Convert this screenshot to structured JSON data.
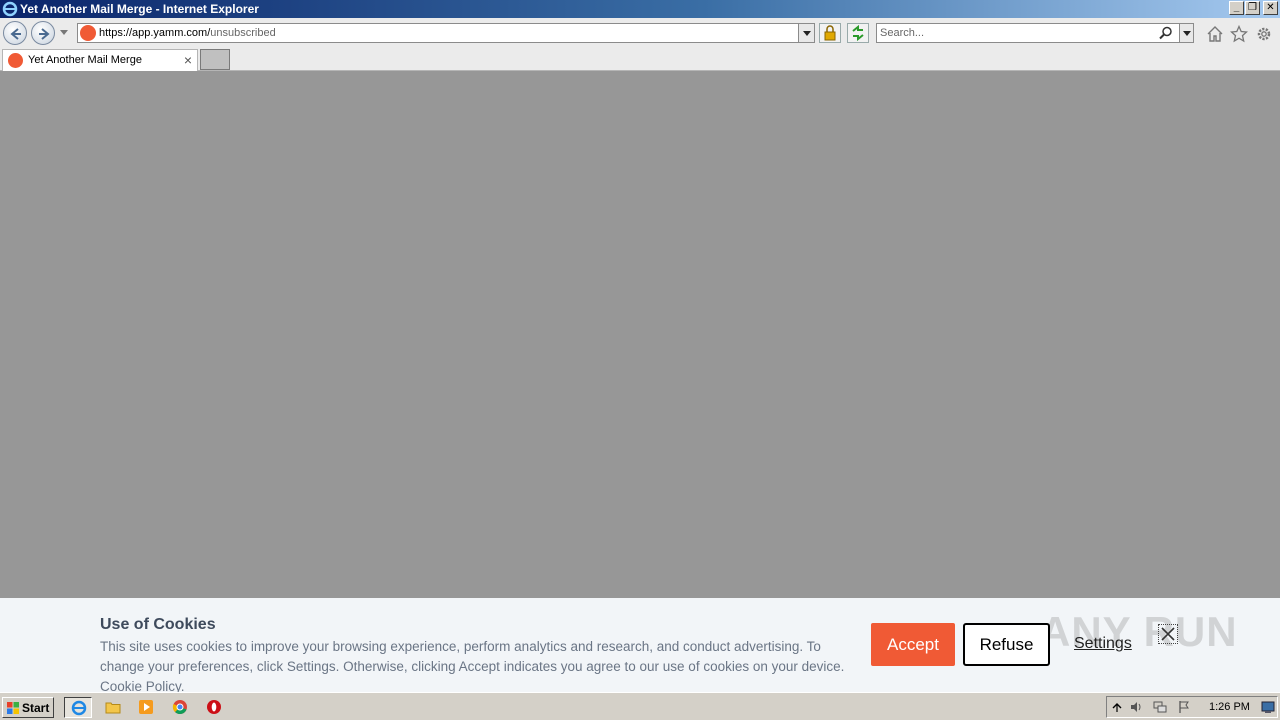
{
  "window": {
    "title": "Yet Another Mail Merge - Internet Explorer",
    "minimize": "_",
    "restore": "❐",
    "close": "✕"
  },
  "address_bar": {
    "url_host": "https://app.yamm.com/",
    "url_path": "unsubscribed"
  },
  "search": {
    "placeholder": "Search..."
  },
  "tab": {
    "label": "Yet Another Mail Merge",
    "close": "×"
  },
  "cookie_banner": {
    "title": "Use of Cookies",
    "text": "This site uses cookies to improve your browsing experience, perform analytics and research, and conduct advertising. To change your preferences, click Settings. Otherwise, clicking Accept indicates you agree to our use of cookies on your device.",
    "policy_link": "Cookie Policy",
    "text_end": ".",
    "accept_label": "Accept",
    "refuse_label": "Refuse",
    "settings_label": "Settings",
    "watermark": "ANY RUN"
  },
  "taskbar": {
    "start_label": "Start",
    "clock": "1:26 PM"
  },
  "colors": {
    "accent": "#f05a35",
    "page_background": "#979797",
    "banner_background": "#f2f5f8"
  },
  "icons": [
    "ie-logo-icon",
    "back-icon",
    "forward-icon",
    "lock-icon",
    "refresh-icon",
    "search-icon",
    "home-icon",
    "favorites-star-icon",
    "gear-icon",
    "close-icon",
    "windows-flag-icon",
    "folder-icon",
    "media-player-icon",
    "chrome-icon",
    "opera-icon",
    "volume-icon",
    "network-icon",
    "flag-icon",
    "show-desktop-icon"
  ]
}
